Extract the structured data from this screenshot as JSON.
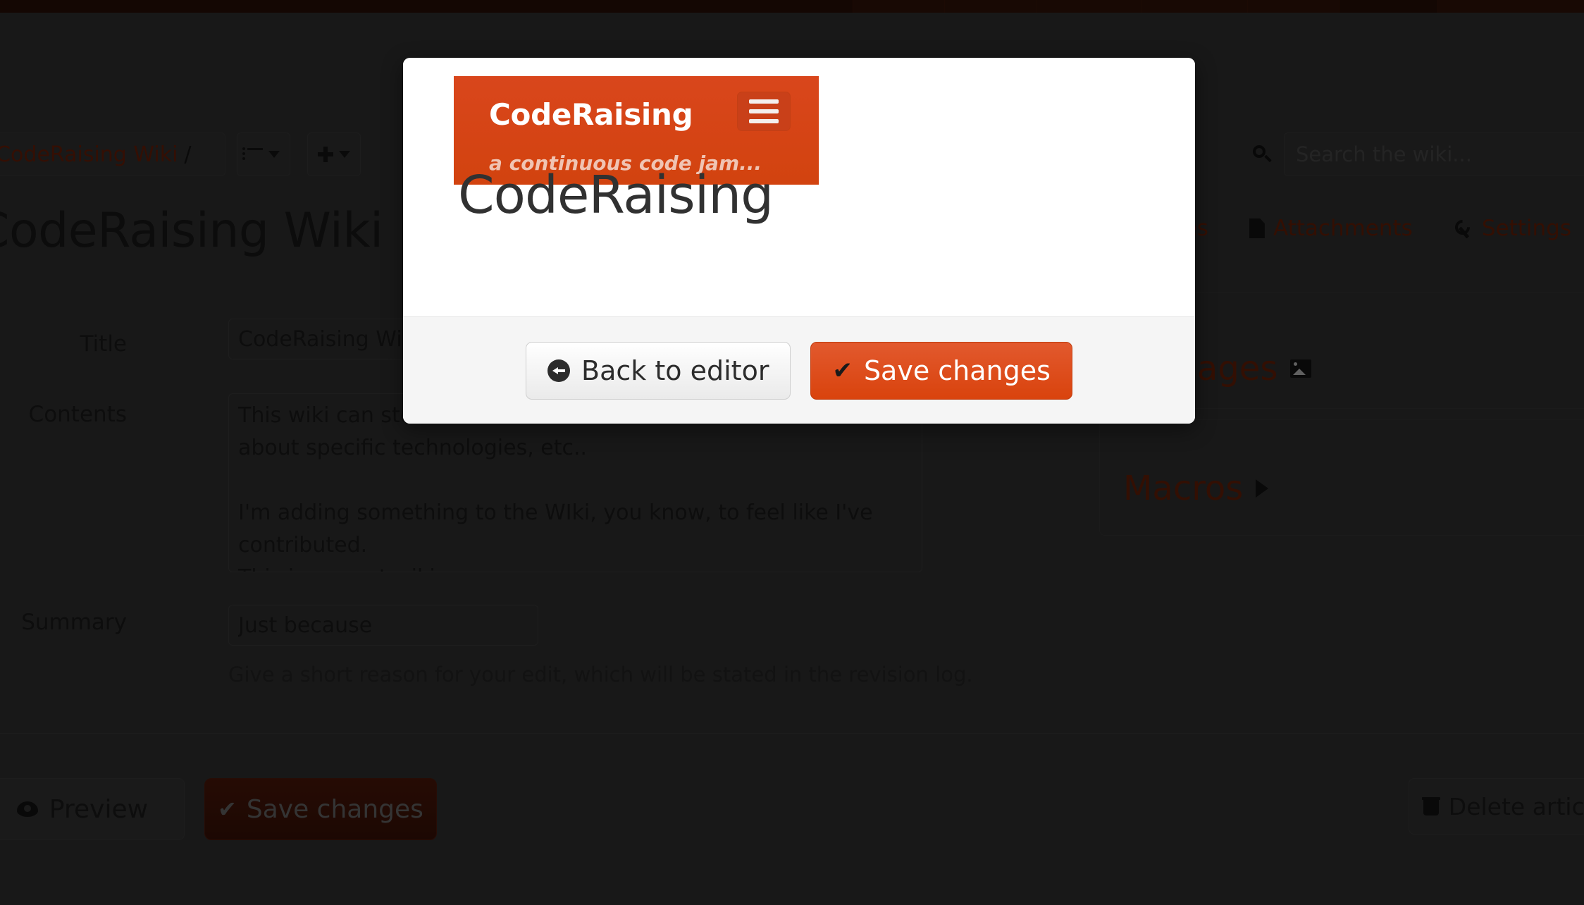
{
  "app": {
    "brand": "CodeRaising",
    "tagline": "a continuous code jam...",
    "accent_color": "#d9431b",
    "page_background": "#333333"
  },
  "toolbar": {
    "breadcrumb": {
      "leading_separator": "/",
      "link_label": "CodeRaising Wiki",
      "trailing_separator": "/"
    },
    "list_dropdown_icon": "list-icon",
    "add_dropdown_icon": "plus-icon",
    "search": {
      "icon": "search-icon",
      "placeholder": "Search the wiki...",
      "value": ""
    }
  },
  "article": {
    "title": "CodeRaising Wiki",
    "tabs": [
      {
        "label": "Changes",
        "icon": "clock-icon"
      },
      {
        "label": "Attachments",
        "icon": "file-icon"
      },
      {
        "label": "Settings",
        "icon": "wrench-icon"
      }
    ]
  },
  "form": {
    "title_label": "Title",
    "title_value": "CodeRaising Wiki",
    "contents_label": "Contents",
    "contents_value": "This wiki can store\nabout specific technologies, etc..\n\nI'm adding something to the WIki, you know, to feel like I've contributed.\nThis is a great wiki.",
    "summary_label": "Summary",
    "summary_value": "Just because",
    "summary_help": "Give a short reason for your edit, which will be stated in the revision log."
  },
  "side_panels": [
    {
      "title": "Images",
      "icon": "image-icon",
      "expander": "caret-right-icon"
    },
    {
      "title": "Macros",
      "icon": "",
      "expander": "caret-right-icon"
    }
  ],
  "bottom_bar": {
    "preview_label": "Preview",
    "preview_icon": "eye-icon",
    "save_label": "Save changes",
    "save_icon": "check-icon",
    "delete_label": "Delete article",
    "delete_icon": "trash-icon"
  },
  "modal": {
    "preview_banner": {
      "brand": "CodeRaising",
      "tagline": "a continuous code jam...",
      "menu_icon": "hamburger-icon"
    },
    "preview_title": "CodeRaising",
    "footer": {
      "back_label": "Back to editor",
      "back_icon": "arrow-left-circle-icon",
      "save_label": "Save changes",
      "save_icon": "check-icon"
    }
  }
}
